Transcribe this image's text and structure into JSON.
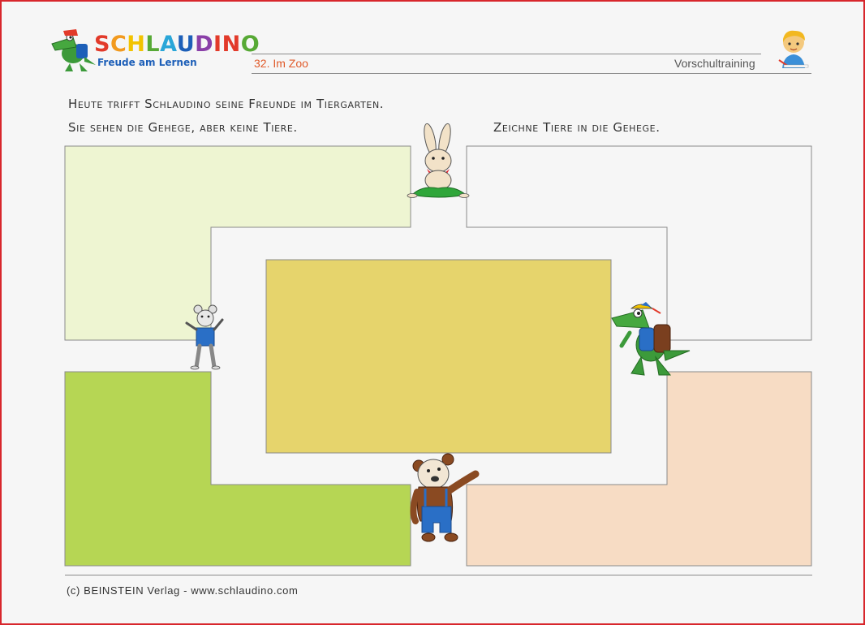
{
  "header": {
    "brand": "SCHLAUDINO",
    "brand_colors": [
      "#e23a2a",
      "#f29a1f",
      "#f2c300",
      "#57a935",
      "#2aa6d8",
      "#1d5fb8",
      "#8a3fa8",
      "#e23a2a",
      "#e23a2a",
      "#57a935"
    ],
    "tagline": "Freude am Lernen",
    "tagline_color": "#1d5fb8",
    "lesson": "32. Im Zoo",
    "lesson_color": "#e05a2a",
    "category": "Vorschultraining"
  },
  "instructions": {
    "line1": "Heute trifft Schlaudino seine Freunde im Tiergarten.",
    "line2": "Sie sehen die Gehege, aber keine Tiere.",
    "line3": "Zeichne Tiere in die Gehege."
  },
  "enclosures": {
    "top_left_color": "#eef5d2",
    "top_right_color": "#f6f6f6",
    "center_color": "#e6d46c",
    "bottom_left_color": "#b6d654",
    "bottom_right_color": "#f7dcc4"
  },
  "characters": [
    "rabbit-icon",
    "mouse-icon",
    "crocodile-icon",
    "bear-icon",
    "boy-icon"
  ],
  "footer": {
    "copyright": "(c) BEINSTEIN Verlag - www.schlaudino.com"
  }
}
